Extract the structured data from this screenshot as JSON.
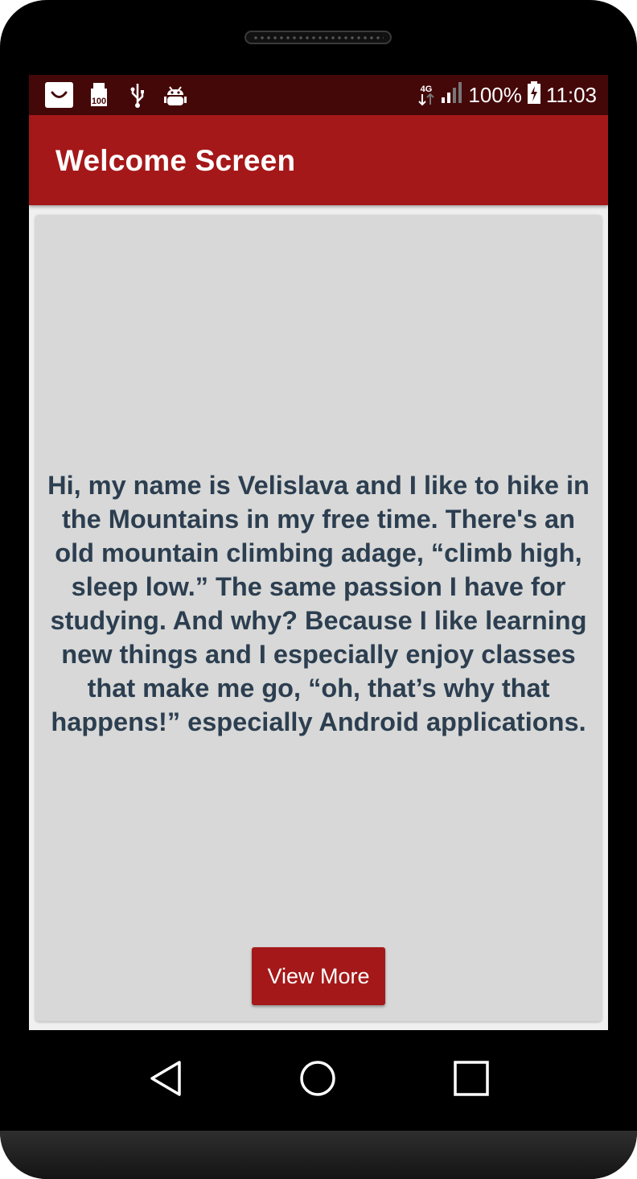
{
  "statusbar": {
    "network": "4G",
    "battery_percent": "100%",
    "time": "11:03",
    "notification_badge": "100",
    "icons": [
      "shopping-bag-icon",
      "sd-card-icon",
      "usb-icon",
      "android-debug-icon"
    ]
  },
  "appbar": {
    "title": "Welcome Screen"
  },
  "card": {
    "bio": "Hi, my name is Velislava and I like to hike in the Mountains in my free time. There's an old mountain climbing adage, “climb high, sleep low.” The same passion I have for studying. And why? Because I like learning new things and I especially enjoy classes that make me go, “oh, that’s why that happens!” especially Android applications.",
    "button_label": "View More"
  },
  "navbar": {
    "icons": [
      "back-icon",
      "home-icon",
      "recents-icon"
    ]
  },
  "colors": {
    "primary": "#a51819",
    "status_bar": "#450809",
    "card_bg": "#d7d8d7",
    "text": "#2c3e50"
  }
}
